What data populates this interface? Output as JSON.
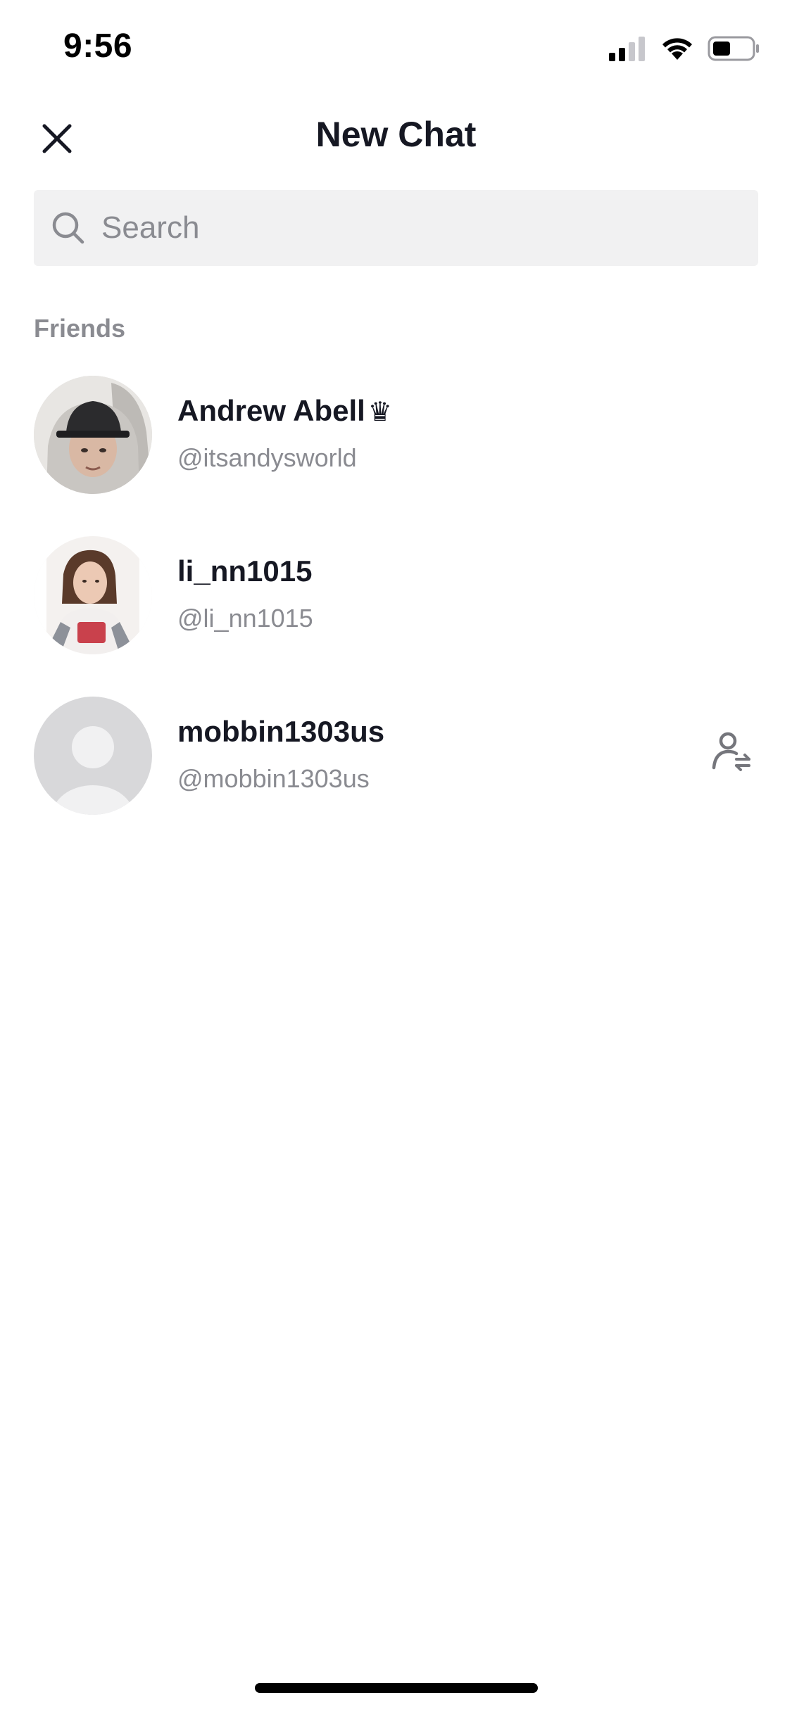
{
  "status_bar": {
    "time": "9:56",
    "icons": [
      "cellular-signal-icon",
      "wifi-icon",
      "battery-icon"
    ]
  },
  "header": {
    "title": "New Chat",
    "close_icon": "close-icon"
  },
  "search": {
    "placeholder": "Search",
    "value": "",
    "icon": "search-icon"
  },
  "section": {
    "label": "Friends"
  },
  "friends": [
    {
      "name": "Andrew Abell",
      "badge": "♛",
      "handle": "@itsandysworld",
      "avatar": "photo-avatar",
      "action_icon": ""
    },
    {
      "name": "li_nn1015",
      "badge": "",
      "handle": "@li_nn1015",
      "avatar": "photo-avatar",
      "action_icon": ""
    },
    {
      "name": "mobbin1303us",
      "badge": "",
      "handle": "@mobbin1303us",
      "avatar": "default-avatar",
      "action_icon": "follow-back-icon"
    }
  ],
  "colors": {
    "text_primary": "#161823",
    "text_secondary": "#8a8b91",
    "search_bg": "#f1f1f2",
    "avatar_placeholder": "#d8d8da"
  }
}
